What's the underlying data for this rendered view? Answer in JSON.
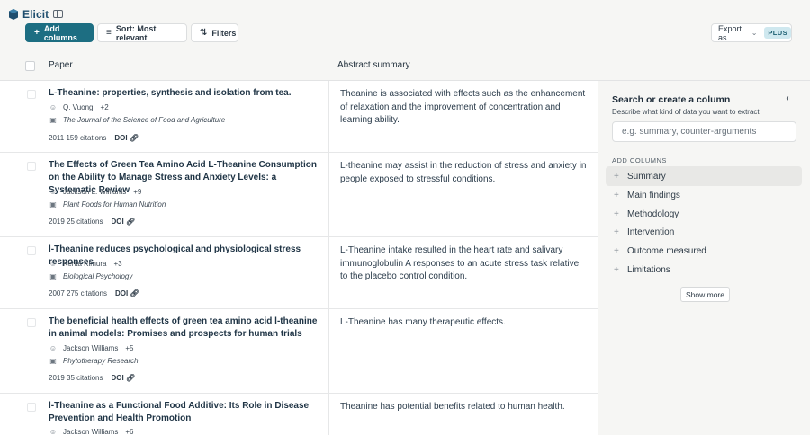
{
  "app": {
    "name": "Elicit"
  },
  "toolbar": {
    "add_columns": "Add columns",
    "sort": "Sort: Most relevant",
    "filters": "Filters",
    "export": "Export as",
    "plus_badge": "PLUS"
  },
  "table": {
    "headers": {
      "paper": "Paper",
      "abstract": "Abstract summary"
    },
    "rows": [
      {
        "title": "L-Theanine: properties, synthesis and isolation from tea.",
        "author": "Q. Vuong",
        "more_authors": "+2",
        "journal": "The Journal of the Science of Food and Agriculture",
        "year": "2011",
        "citations": "159 citations",
        "doi": "DOI",
        "abstract": "Theanine is associated with effects such as the enhancement of relaxation and the improvement of concentration and learning ability."
      },
      {
        "title": "The Effects of Green Tea Amino Acid L-Theanine Consumption on the Ability to Manage Stress and Anxiety Levels: a Systematic Review",
        "author": "Jackson L. Williams",
        "more_authors": "+9",
        "journal": "Plant Foods for Human Nutrition",
        "year": "2019",
        "citations": "25 citations",
        "doi": "DOI",
        "abstract": "L-theanine may assist in the reduction of stress and anxiety in people exposed to stressful conditions."
      },
      {
        "title": "l-Theanine reduces psychological and physiological stress responses",
        "author": "Kenta  Kimura",
        "more_authors": "+3",
        "journal": "Biological Psychology",
        "year": "2007",
        "citations": "275 citations",
        "doi": "DOI",
        "abstract": "L-Theanine intake resulted in the heart rate and salivary immunoglobulin A responses to an acute stress task relative to the placebo control condition."
      },
      {
        "title": "The beneficial health effects of green tea amino acid l-theanine in animal models: Promises and prospects for human trials",
        "author": "Jackson Williams",
        "more_authors": "+5",
        "journal": "Phytotherapy Research",
        "year": "2019",
        "citations": "35 citations",
        "doi": "DOI",
        "abstract": "L-Theanine has many therapeutic effects."
      },
      {
        "title": "l-Theanine as a Functional Food Additive: Its Role in Disease Prevention and Health Promotion",
        "author": "Jackson Williams",
        "more_authors": "+6",
        "abstract": "Theanine has potential benefits related to human health."
      }
    ]
  },
  "panel": {
    "title": "Search or create a column",
    "subtitle": "Describe what kind of data you want to extract",
    "input_placeholder": "e.g. summary, counter-arguments",
    "section": "ADD COLUMNS",
    "items": [
      "Summary",
      "Main findings",
      "Methodology",
      "Intervention",
      "Outcome measured",
      "Limitations"
    ],
    "show_more": "Show more"
  }
}
